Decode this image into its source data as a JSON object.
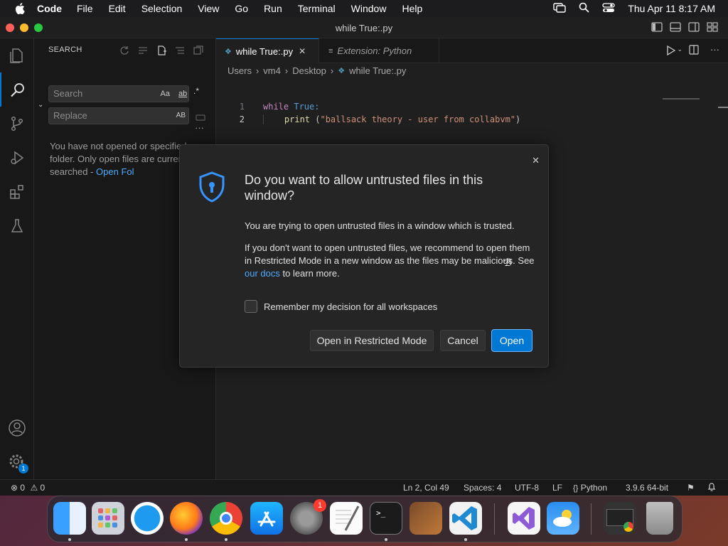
{
  "menubar": {
    "app_name": "Code",
    "items": [
      "File",
      "Edit",
      "Selection",
      "View",
      "Go",
      "Run",
      "Terminal",
      "Window",
      "Help"
    ],
    "clock": "Thu Apr 11  8:17 AM"
  },
  "window": {
    "title": "while True:.py"
  },
  "sidebar": {
    "title": "SEARCH",
    "search_placeholder": "Search",
    "replace_placeholder": "Replace",
    "match_case": "Aa",
    "whole_word": "ab",
    "regex": ".*",
    "preserve_case": "AB",
    "message": "You have not opened or specified a folder. Only open files are currently searched - ",
    "message_link": "Open Fol"
  },
  "editor": {
    "tabs": [
      {
        "label": "while True:.py",
        "active": true
      },
      {
        "label": "Extension: Python",
        "active": false
      }
    ],
    "breadcrumb": [
      "Users",
      "vm4",
      "Desktop",
      "while True:.py"
    ],
    "lines": [
      {
        "num": "1",
        "keyword": "while",
        "rest": " True:"
      },
      {
        "num": "2",
        "indent": "    ",
        "fn": "print",
        "rest": " (",
        "string": "\"ballsack theory - user from collabvm\"",
        "end": ")"
      }
    ]
  },
  "dialog": {
    "title": "Do you want to allow untrusted files in this window?",
    "para1": "You are trying to open untrusted files in a window which is trusted.",
    "para2_a": "If you don't want to open untrusted files, we recommend to open them in Restricted Mode in a new window as the files may be malicious. See ",
    "para2_link": "our docs",
    "para2_b": " to learn more.",
    "checkbox_label": "Remember my decision for all workspaces",
    "buttons": {
      "restricted": "Open in Restricted Mode",
      "cancel": "Cancel",
      "open": "Open"
    }
  },
  "statusbar": {
    "errors": "0",
    "warnings": "0",
    "position": "Ln 2, Col 49",
    "spaces": "Spaces: 4",
    "encoding": "UTF-8",
    "eol": "LF",
    "language": "Python",
    "interpreter": "3.9.6 64-bit"
  },
  "activity": {
    "settings_badge": "1"
  },
  "dock": {
    "settings_badge": "1",
    "apps": [
      "finder",
      "launchpad",
      "safari",
      "firefox",
      "chrome",
      "app-store",
      "system-settings",
      "textedit",
      "terminal",
      "instruments",
      "vscode",
      "visual-studio",
      "weather",
      "chrome-window",
      "trash"
    ]
  },
  "colors": {
    "accent": "#0078d4",
    "link": "#4daafc",
    "keyword": "#c586c0",
    "string": "#ce9178",
    "function": "#dcdcaa",
    "constant": "#569cd6"
  }
}
